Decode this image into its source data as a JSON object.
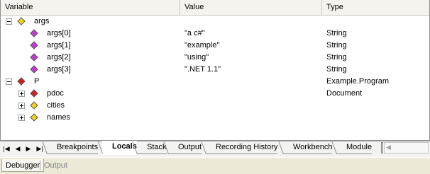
{
  "columns": {
    "variable": "Variable",
    "value": "Value",
    "type": "Type"
  },
  "colors": {
    "header_bg": "#f4f3ee",
    "grid_bg": "#ffffff",
    "diamond_yellow": "#f3d41d",
    "diamond_purple": "#c43ad6",
    "diamond_red": "#d21f1f",
    "active_tab_bg": "#ffffff"
  },
  "rows": [
    {
      "name": "args",
      "value": "",
      "type": "",
      "expander": "minus",
      "icon": "yellow-diamond-icon"
    },
    {
      "name": "args[0]",
      "value": "\"a c#\"",
      "type": "String",
      "expander": "none",
      "icon": "purple-diamond-icon"
    },
    {
      "name": "args[1]",
      "value": "\"example\"",
      "type": "String",
      "expander": "none",
      "icon": "purple-diamond-icon"
    },
    {
      "name": "args[2]",
      "value": "\"using\"",
      "type": "String",
      "expander": "none",
      "icon": "purple-diamond-icon"
    },
    {
      "name": "args[3]",
      "value": "\".NET 1.1\"",
      "type": "String",
      "expander": "none",
      "icon": "purple-diamond-icon"
    },
    {
      "name": "P",
      "value": "",
      "type": "Example.Program",
      "expander": "minus",
      "icon": "red-diamond-icon"
    },
    {
      "name": "pdoc",
      "value": "",
      "type": "Document",
      "expander": "plus",
      "icon": "red-diamond-icon"
    },
    {
      "name": "cities",
      "value": "",
      "type": "",
      "expander": "plus",
      "icon": "yellow-diamond-icon"
    },
    {
      "name": "names",
      "value": "",
      "type": "",
      "expander": "plus",
      "icon": "yellow-diamond-icon"
    }
  ],
  "nav": {
    "first": "|◀",
    "prev": "◀",
    "next": "▶",
    "last": "▶|"
  },
  "tabs": [
    "Breakpoints",
    "Locals",
    "Stack",
    "Output",
    "Recording History",
    "Workbench",
    "Module"
  ],
  "active_tab": "Locals",
  "window_tabs": {
    "debugger": "Debugger",
    "output": "Output"
  }
}
